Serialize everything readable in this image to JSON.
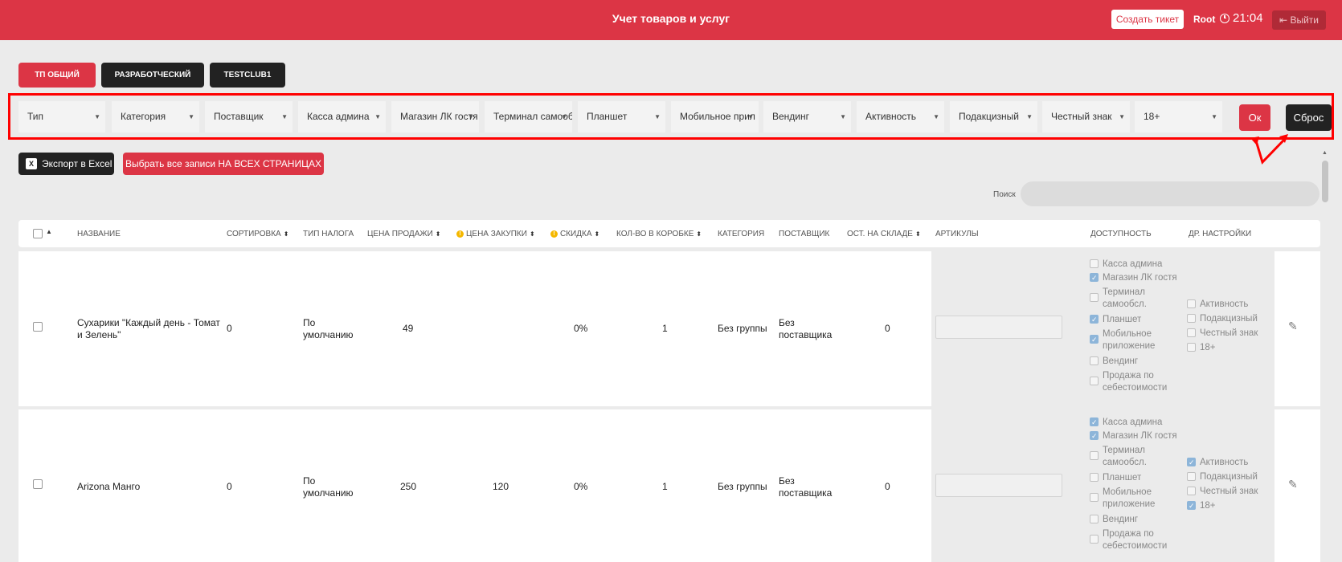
{
  "header": {
    "title": "Учет товаров и услуг",
    "create_ticket": "Создать тикет",
    "user": "Root",
    "time": "21:04",
    "logout": "Выйти"
  },
  "tabs": [
    "ТП ОБЩИЙ",
    "РАЗРАБОТЧЕСКИЙ",
    "TESTCLUB1"
  ],
  "filters": [
    "Тип",
    "Категория",
    "Поставщик",
    "Касса админа",
    "Магазин ЛК гостя",
    "Терминал самообс",
    "Планшет",
    "Мобильное прил",
    "Вендинг",
    "Активность",
    "Подакцизный",
    "Честный знак",
    "18+"
  ],
  "filter_actions": {
    "ok": "Ок",
    "reset": "Сброс"
  },
  "actions": {
    "excel": "Экспорт в Excel",
    "select_all": "Выбрать все записи НА ВСЕХ СТРАНИЦАХ"
  },
  "search": {
    "label": "Поиск"
  },
  "columns": [
    "НАЗВАНИЕ",
    "СОРТИРОВКА",
    "ТИП НАЛОГА",
    "ЦЕНА ПРОДАЖИ",
    "ЦЕНА ЗАКУПКИ",
    "СКИДКА",
    "КОЛ-ВО В КОРОБКЕ",
    "КАТЕГОРИЯ",
    "ПОСТАВЩИК",
    "ОСТ. НА СКЛАДЕ",
    "АРТИКУЛЫ",
    "ДОСТУПНОСТЬ",
    "ДР. НАСТРОЙКИ"
  ],
  "rows": [
    {
      "name": "Сухарики \"Каждый день - Томат и Зелень\"",
      "sort": "0",
      "tax": "По умолчанию",
      "price": "49",
      "cost": "",
      "discount": "0%",
      "box_qty": "1",
      "category": "Без группы",
      "supplier": "Без поставщика",
      "stock": "0",
      "availability": [
        {
          "label": "Касса админа",
          "checked": false
        },
        {
          "label": "Магазин ЛК гостя",
          "checked": true
        },
        {
          "label": "Терминал самообсл.",
          "checked": false
        },
        {
          "label": "Планшет",
          "checked": true
        },
        {
          "label": "Мобильное приложение",
          "checked": true
        },
        {
          "label": "Вендинг",
          "checked": false
        },
        {
          "label": "Продажа по себестоимости",
          "checked": false
        }
      ],
      "other": [
        {
          "label": "Активность",
          "checked": false
        },
        {
          "label": "Подакцизный",
          "checked": false
        },
        {
          "label": "Честный знак",
          "checked": false
        },
        {
          "label": "18+",
          "checked": false
        }
      ]
    },
    {
      "name": "Arizona Манго",
      "sort": "0",
      "tax": "По умолчанию",
      "price": "250",
      "cost": "120",
      "discount": "0%",
      "box_qty": "1",
      "category": "Без группы",
      "supplier": "Без поставщика",
      "stock": "0",
      "availability": [
        {
          "label": "Касса админа",
          "checked": true
        },
        {
          "label": "Магазин ЛК гостя",
          "checked": true
        },
        {
          "label": "Терминал самообсл.",
          "checked": false
        },
        {
          "label": "Планшет",
          "checked": false
        },
        {
          "label": "Мобильное приложение",
          "checked": false
        },
        {
          "label": "Вендинг",
          "checked": false
        },
        {
          "label": "Продажа по себестоимости",
          "checked": false
        }
      ],
      "other": [
        {
          "label": "Активность",
          "checked": true
        },
        {
          "label": "Подакцизный",
          "checked": false
        },
        {
          "label": "Честный знак",
          "checked": false
        },
        {
          "label": "18+",
          "checked": true
        }
      ]
    }
  ],
  "colors": {
    "accent": "#dc3545",
    "dark": "#222222",
    "annotation": "#ff0000"
  }
}
